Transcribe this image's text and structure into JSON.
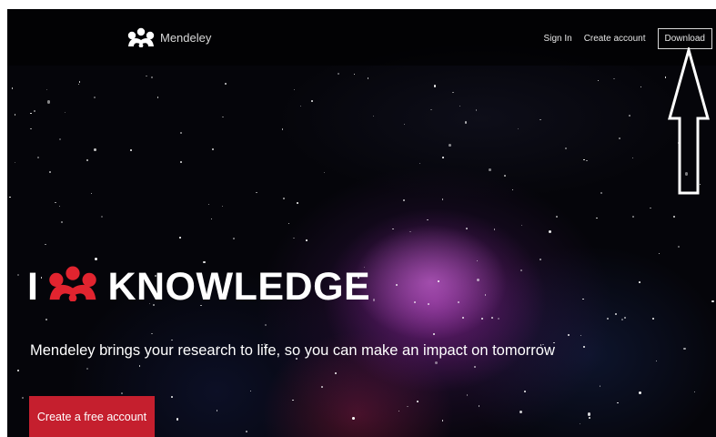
{
  "header": {
    "brand_name": "Mendeley",
    "brand_icon": "mendeley-logo-icon",
    "nav": {
      "sign_in": "Sign In",
      "create_account": "Create account",
      "download": "Download"
    }
  },
  "hero": {
    "title_prefix": "I",
    "title_icon": "mendeley-logo-icon",
    "title_word": "KNOWLEDGE",
    "subtitle": "Mendeley brings your research to life, so you can make an impact on tomorrow",
    "cta_label": "Create a free account"
  },
  "annotation": {
    "icon": "up-arrow-icon"
  },
  "colors": {
    "accent": "#c51f2e",
    "logo_red": "#e1242f",
    "nav_text": "#e6e6e6",
    "background": "#05050a"
  }
}
